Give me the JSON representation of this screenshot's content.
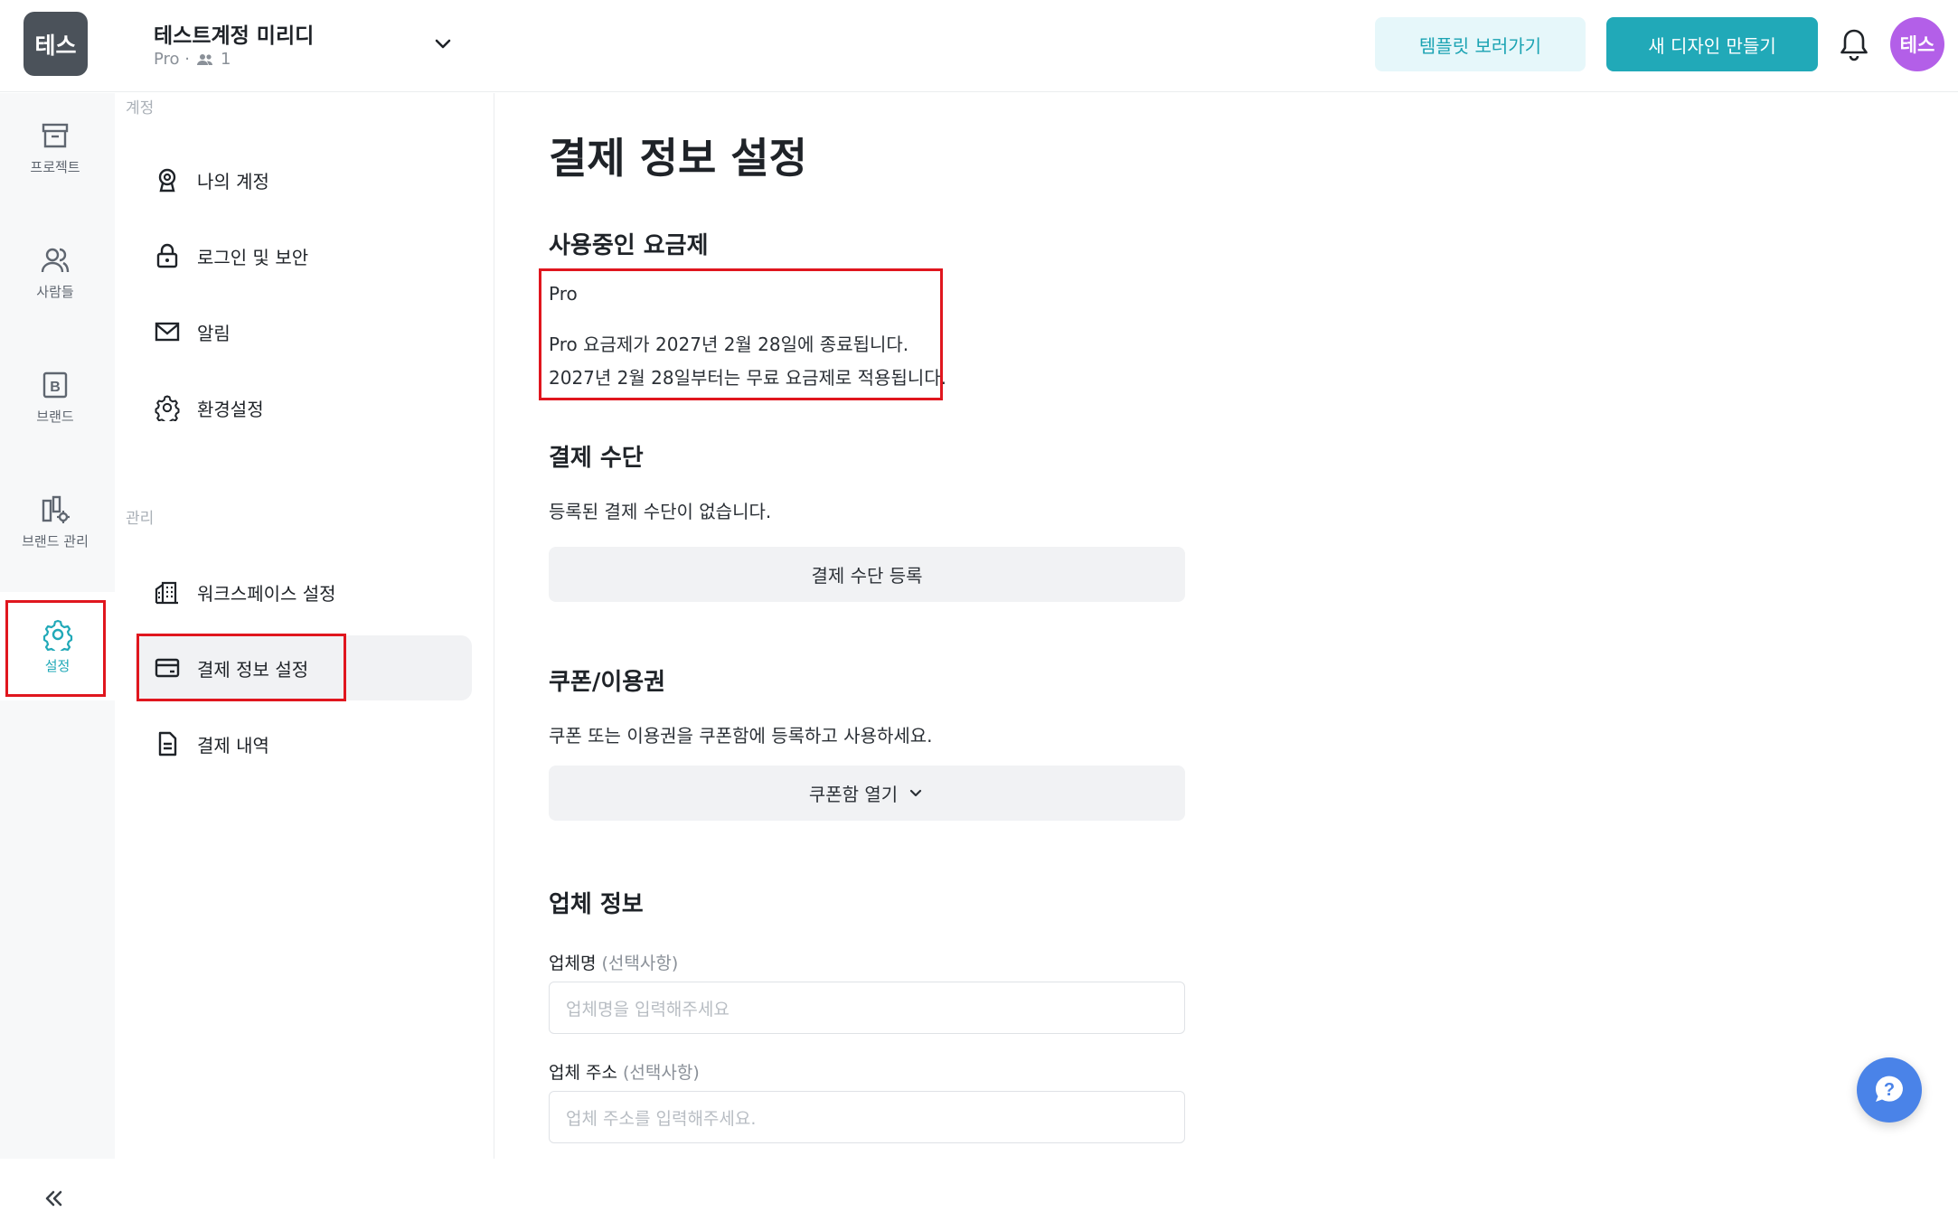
{
  "topbar": {
    "workspace_logo": "테스",
    "workspace_name": "테스트계정 미리디",
    "workspace_plan": "Pro ·",
    "workspace_members": "1",
    "template_button": "템플릿 보러가기",
    "new_design_button": "새 디자인 만들기",
    "avatar": "테스"
  },
  "rail": {
    "items": [
      {
        "label": "프로젝트",
        "icon": "archive-icon"
      },
      {
        "label": "사람들",
        "icon": "people-icon"
      },
      {
        "label": "브랜드",
        "icon": "brand-icon"
      },
      {
        "label": "브랜드 관리",
        "icon": "brand-manage-icon"
      },
      {
        "label": "설정",
        "icon": "gear-icon",
        "active": true
      }
    ]
  },
  "submenu": {
    "section_account": "계정",
    "section_manage": "관리",
    "account_items": [
      "나의 계정",
      "로그인 및 보안",
      "알림",
      "환경설정"
    ],
    "manage_items": [
      "워크스페이스 설정",
      "결제 정보 설정",
      "결제 내역"
    ],
    "active_item": "결제 정보 설정"
  },
  "main": {
    "page_title": "결제 정보 설정",
    "plan_heading": "사용중인 요금제",
    "plan_name": "Pro",
    "plan_line1": "Pro 요금제가 2027년 2월 28일에 종료됩니다.",
    "plan_line2": "2027년 2월 28일부터는 무료 요금제로 적용됩니다.",
    "payment_heading": "결제 수단",
    "payment_text": "등록된 결제 수단이 없습니다.",
    "payment_button": "결제 수단 등록",
    "coupon_heading": "쿠폰/이용권",
    "coupon_text": "쿠폰 또는 이용권을 쿠폰함에 등록하고 사용하세요.",
    "coupon_button": "쿠폰함 열기",
    "company_heading": "업체 정보",
    "company_name_label": "업체명",
    "company_name_optional": "(선택사항)",
    "company_name_placeholder": "업체명을 입력해주세요",
    "company_address_label": "업체 주소",
    "company_address_optional": "(선택사항)",
    "company_address_placeholder": "업체 주소를 입력해주세요."
  },
  "colors": {
    "accent": "#21a9b8",
    "highlight": "#e0161e",
    "avatar": "#b35fe8",
    "help": "#4a83e8"
  }
}
